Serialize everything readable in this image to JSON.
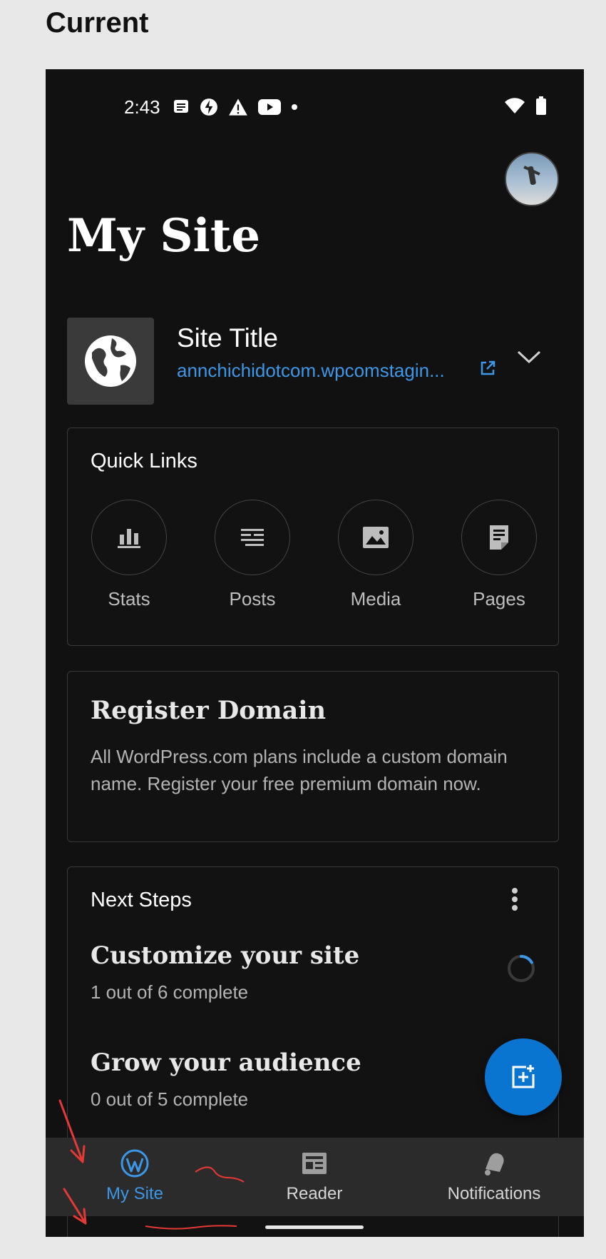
{
  "header_label": "Current",
  "status_bar": {
    "time": "2:43"
  },
  "page": {
    "title": "My Site"
  },
  "site": {
    "title": "Site Title",
    "url": "annchichidotcom.wpcomstagin..."
  },
  "quick_links": {
    "title": "Quick Links",
    "items": [
      {
        "label": "Stats",
        "icon": "stats-icon"
      },
      {
        "label": "Posts",
        "icon": "posts-icon"
      },
      {
        "label": "Media",
        "icon": "media-icon"
      },
      {
        "label": "Pages",
        "icon": "pages-icon"
      }
    ]
  },
  "register_domain": {
    "title": "Register Domain",
    "body": "All WordPress.com plans include a custom domain name. Register your free premium domain now."
  },
  "next_steps": {
    "title": "Next Steps",
    "items": [
      {
        "title": "Customize your site",
        "subtitle": "1 out of 6 complete",
        "progress": 0.1667
      },
      {
        "title": "Grow your audience",
        "subtitle": "0 out of 5 complete",
        "progress": 0
      }
    ]
  },
  "bottom_nav": {
    "items": [
      {
        "label": "My Site",
        "active": true
      },
      {
        "label": "Reader",
        "active": false
      },
      {
        "label": "Notifications",
        "active": false
      }
    ]
  },
  "colors": {
    "accent": "#3d97e6",
    "fab": "#0a75d1",
    "background": "#111111",
    "annotation": "#e53935"
  }
}
